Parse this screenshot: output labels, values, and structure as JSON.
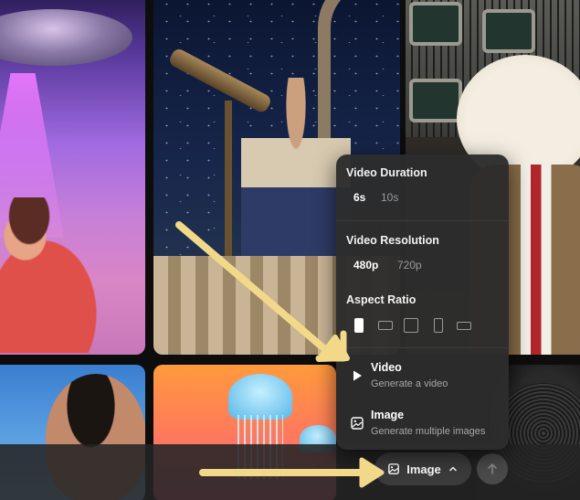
{
  "gallery": {
    "tiles": [
      "ufo",
      "telescope",
      "dog",
      "man",
      "jellyfish",
      "portrait"
    ]
  },
  "settings": {
    "duration": {
      "title": "Video Duration",
      "options": [
        "6s",
        "10s"
      ],
      "selected": "6s"
    },
    "resolution": {
      "title": "Video Resolution",
      "options": [
        "480p",
        "720p"
      ],
      "selected": "480p"
    },
    "aspect": {
      "title": "Aspect Ratio",
      "options": [
        "9:16",
        "16:9",
        "1:1",
        "2:3",
        "3:2"
      ],
      "selected": "9:16"
    },
    "modes": [
      {
        "title": "Video",
        "subtitle": "Generate a video",
        "icon": "play-icon"
      },
      {
        "title": "Image",
        "subtitle": "Generate multiple images",
        "icon": "image-icon"
      }
    ]
  },
  "prompt_bar": {
    "mode_label": "Image",
    "mode_icon": "image-icon",
    "send_icon": "arrow-up-icon"
  },
  "colors": {
    "annotation_arrow": "#f2d98a",
    "panel": "#2c2c2c"
  }
}
